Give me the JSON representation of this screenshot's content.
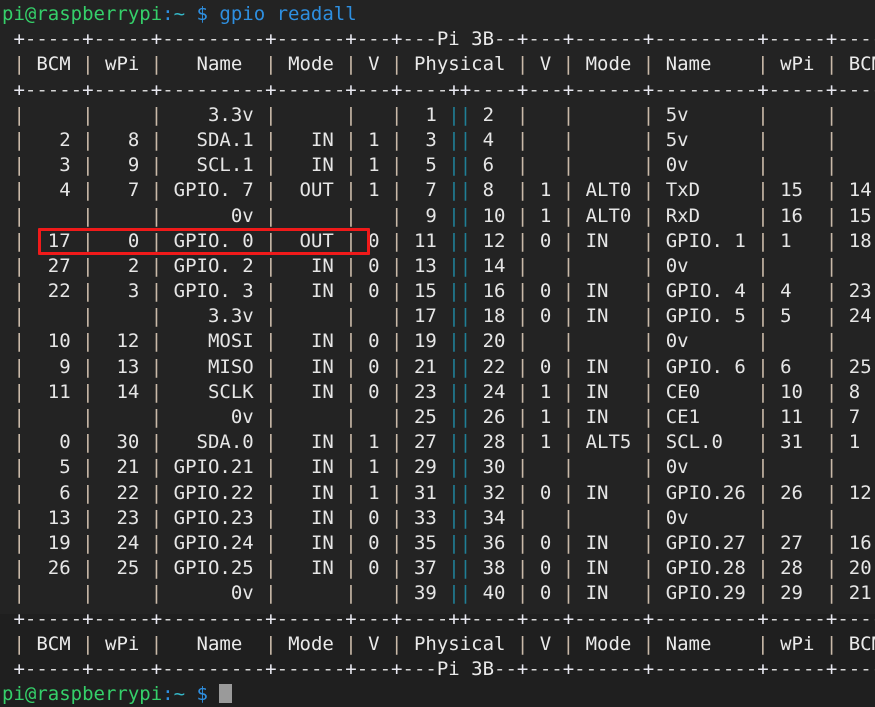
{
  "terminal": {
    "background_color": "#232323",
    "foreground_color": "#d8d8d8",
    "prompt": {
      "user_host": "pi@raspberrypi",
      "colon": ":",
      "path": "~",
      "sigil": "$",
      "user_host_color": "#35d06a",
      "path_color": "#35b8c8",
      "sigil_color": "#2e8fe0"
    },
    "command": "gpio readall",
    "command_color": "#2e8fe0",
    "cursor_color": "#9a9a9a"
  },
  "table": {
    "title": "Pi 3B",
    "headers": [
      "BCM",
      "wPi",
      "Name",
      "Mode",
      "V",
      "Physical",
      "V",
      "Mode",
      "Name",
      "wPi",
      "BCM"
    ],
    "top_border": " +-----+-----+---------+------+---+---Pi 3B--+---+------+---------+-----+-----+",
    "header_row": " | BCM | wPi |   Name  | Mode | V | Physical | V | Mode | Name    | wPi | BCM |",
    "header_rule": " +-----+-----+---------+------+---+----++----+---+------+---------+-----+-----+",
    "footer_rule": " +-----+-----+---------+------+---+----++----+---+------+---------+-----+-----+",
    "footer_row": " | BCM | wPi |   Name  | Mode | V | Physical | V | Mode | Name    | wPi | BCM |",
    "bottom_border": " +-----+-----+---------+------+---+---Pi 3B--+---+------+---------+-----+-----+",
    "rows": [
      {
        "bcm_l": "",
        "wpi_l": "",
        "name_l": "3.3v",
        "mode_l": "",
        "v_l": "",
        "phys_l": "1",
        "phys_r": "2",
        "v_r": "",
        "mode_r": "",
        "name_r": "5v",
        "wpi_r": "",
        "bcm_r": ""
      },
      {
        "bcm_l": "2",
        "wpi_l": "8",
        "name_l": "SDA.1",
        "mode_l": "IN",
        "v_l": "1",
        "phys_l": "3",
        "phys_r": "4",
        "v_r": "",
        "mode_r": "",
        "name_r": "5v",
        "wpi_r": "",
        "bcm_r": ""
      },
      {
        "bcm_l": "3",
        "wpi_l": "9",
        "name_l": "SCL.1",
        "mode_l": "IN",
        "v_l": "1",
        "phys_l": "5",
        "phys_r": "6",
        "v_r": "",
        "mode_r": "",
        "name_r": "0v",
        "wpi_r": "",
        "bcm_r": ""
      },
      {
        "bcm_l": "4",
        "wpi_l": "7",
        "name_l": "GPIO. 7",
        "mode_l": "OUT",
        "v_l": "1",
        "phys_l": "7",
        "phys_r": "8",
        "v_r": "1",
        "mode_r": "ALT0",
        "name_r": "TxD",
        "wpi_r": "15",
        "bcm_r": "14"
      },
      {
        "bcm_l": "",
        "wpi_l": "",
        "name_l": "0v",
        "mode_l": "",
        "v_l": "",
        "phys_l": "9",
        "phys_r": "10",
        "v_r": "1",
        "mode_r": "ALT0",
        "name_r": "RxD",
        "wpi_r": "16",
        "bcm_r": "15"
      },
      {
        "bcm_l": "17",
        "wpi_l": "0",
        "name_l": "GPIO. 0",
        "mode_l": "OUT",
        "v_l": "0",
        "phys_l": "11",
        "phys_r": "12",
        "v_r": "0",
        "mode_r": "IN",
        "name_r": "GPIO. 1",
        "wpi_r": "1",
        "bcm_r": "18",
        "highlighted": true
      },
      {
        "bcm_l": "27",
        "wpi_l": "2",
        "name_l": "GPIO. 2",
        "mode_l": "IN",
        "v_l": "0",
        "phys_l": "13",
        "phys_r": "14",
        "v_r": "",
        "mode_r": "",
        "name_r": "0v",
        "wpi_r": "",
        "bcm_r": ""
      },
      {
        "bcm_l": "22",
        "wpi_l": "3",
        "name_l": "GPIO. 3",
        "mode_l": "IN",
        "v_l": "0",
        "phys_l": "15",
        "phys_r": "16",
        "v_r": "0",
        "mode_r": "IN",
        "name_r": "GPIO. 4",
        "wpi_r": "4",
        "bcm_r": "23"
      },
      {
        "bcm_l": "",
        "wpi_l": "",
        "name_l": "3.3v",
        "mode_l": "",
        "v_l": "",
        "phys_l": "17",
        "phys_r": "18",
        "v_r": "0",
        "mode_r": "IN",
        "name_r": "GPIO. 5",
        "wpi_r": "5",
        "bcm_r": "24"
      },
      {
        "bcm_l": "10",
        "wpi_l": "12",
        "name_l": "MOSI",
        "mode_l": "IN",
        "v_l": "0",
        "phys_l": "19",
        "phys_r": "20",
        "v_r": "",
        "mode_r": "",
        "name_r": "0v",
        "wpi_r": "",
        "bcm_r": ""
      },
      {
        "bcm_l": "9",
        "wpi_l": "13",
        "name_l": "MISO",
        "mode_l": "IN",
        "v_l": "0",
        "phys_l": "21",
        "phys_r": "22",
        "v_r": "0",
        "mode_r": "IN",
        "name_r": "GPIO. 6",
        "wpi_r": "6",
        "bcm_r": "25"
      },
      {
        "bcm_l": "11",
        "wpi_l": "14",
        "name_l": "SCLK",
        "mode_l": "IN",
        "v_l": "0",
        "phys_l": "23",
        "phys_r": "24",
        "v_r": "1",
        "mode_r": "IN",
        "name_r": "CE0",
        "wpi_r": "10",
        "bcm_r": "8"
      },
      {
        "bcm_l": "",
        "wpi_l": "",
        "name_l": "0v",
        "mode_l": "",
        "v_l": "",
        "phys_l": "25",
        "phys_r": "26",
        "v_r": "1",
        "mode_r": "IN",
        "name_r": "CE1",
        "wpi_r": "11",
        "bcm_r": "7"
      },
      {
        "bcm_l": "0",
        "wpi_l": "30",
        "name_l": "SDA.0",
        "mode_l": "IN",
        "v_l": "1",
        "phys_l": "27",
        "phys_r": "28",
        "v_r": "1",
        "mode_r": "ALT5",
        "name_r": "SCL.0",
        "wpi_r": "31",
        "bcm_r": "1"
      },
      {
        "bcm_l": "5",
        "wpi_l": "21",
        "name_l": "GPIO.21",
        "mode_l": "IN",
        "v_l": "1",
        "phys_l": "29",
        "phys_r": "30",
        "v_r": "",
        "mode_r": "",
        "name_r": "0v",
        "wpi_r": "",
        "bcm_r": ""
      },
      {
        "bcm_l": "6",
        "wpi_l": "22",
        "name_l": "GPIO.22",
        "mode_l": "IN",
        "v_l": "1",
        "phys_l": "31",
        "phys_r": "32",
        "v_r": "0",
        "mode_r": "IN",
        "name_r": "GPIO.26",
        "wpi_r": "26",
        "bcm_r": "12"
      },
      {
        "bcm_l": "13",
        "wpi_l": "23",
        "name_l": "GPIO.23",
        "mode_l": "IN",
        "v_l": "0",
        "phys_l": "33",
        "phys_r": "34",
        "v_r": "",
        "mode_r": "",
        "name_r": "0v",
        "wpi_r": "",
        "bcm_r": ""
      },
      {
        "bcm_l": "19",
        "wpi_l": "24",
        "name_l": "GPIO.24",
        "mode_l": "IN",
        "v_l": "0",
        "phys_l": "35",
        "phys_r": "36",
        "v_r": "0",
        "mode_r": "IN",
        "name_r": "GPIO.27",
        "wpi_r": "27",
        "bcm_r": "16"
      },
      {
        "bcm_l": "26",
        "wpi_l": "25",
        "name_l": "GPIO.25",
        "mode_l": "IN",
        "v_l": "0",
        "phys_l": "37",
        "phys_r": "38",
        "v_r": "0",
        "mode_r": "IN",
        "name_r": "GPIO.28",
        "wpi_r": "28",
        "bcm_r": "20"
      },
      {
        "bcm_l": "",
        "wpi_l": "",
        "name_l": "0v",
        "mode_l": "",
        "v_l": "",
        "phys_l": "39",
        "phys_r": "40",
        "v_r": "0",
        "mode_r": "IN",
        "name_r": "GPIO.29",
        "wpi_r": "29",
        "bcm_r": "21"
      }
    ]
  },
  "annotation": {
    "type": "rectangle",
    "color": "#f01a1a",
    "target_row_index": 5,
    "label": "GPIO. 0 row highlight"
  }
}
